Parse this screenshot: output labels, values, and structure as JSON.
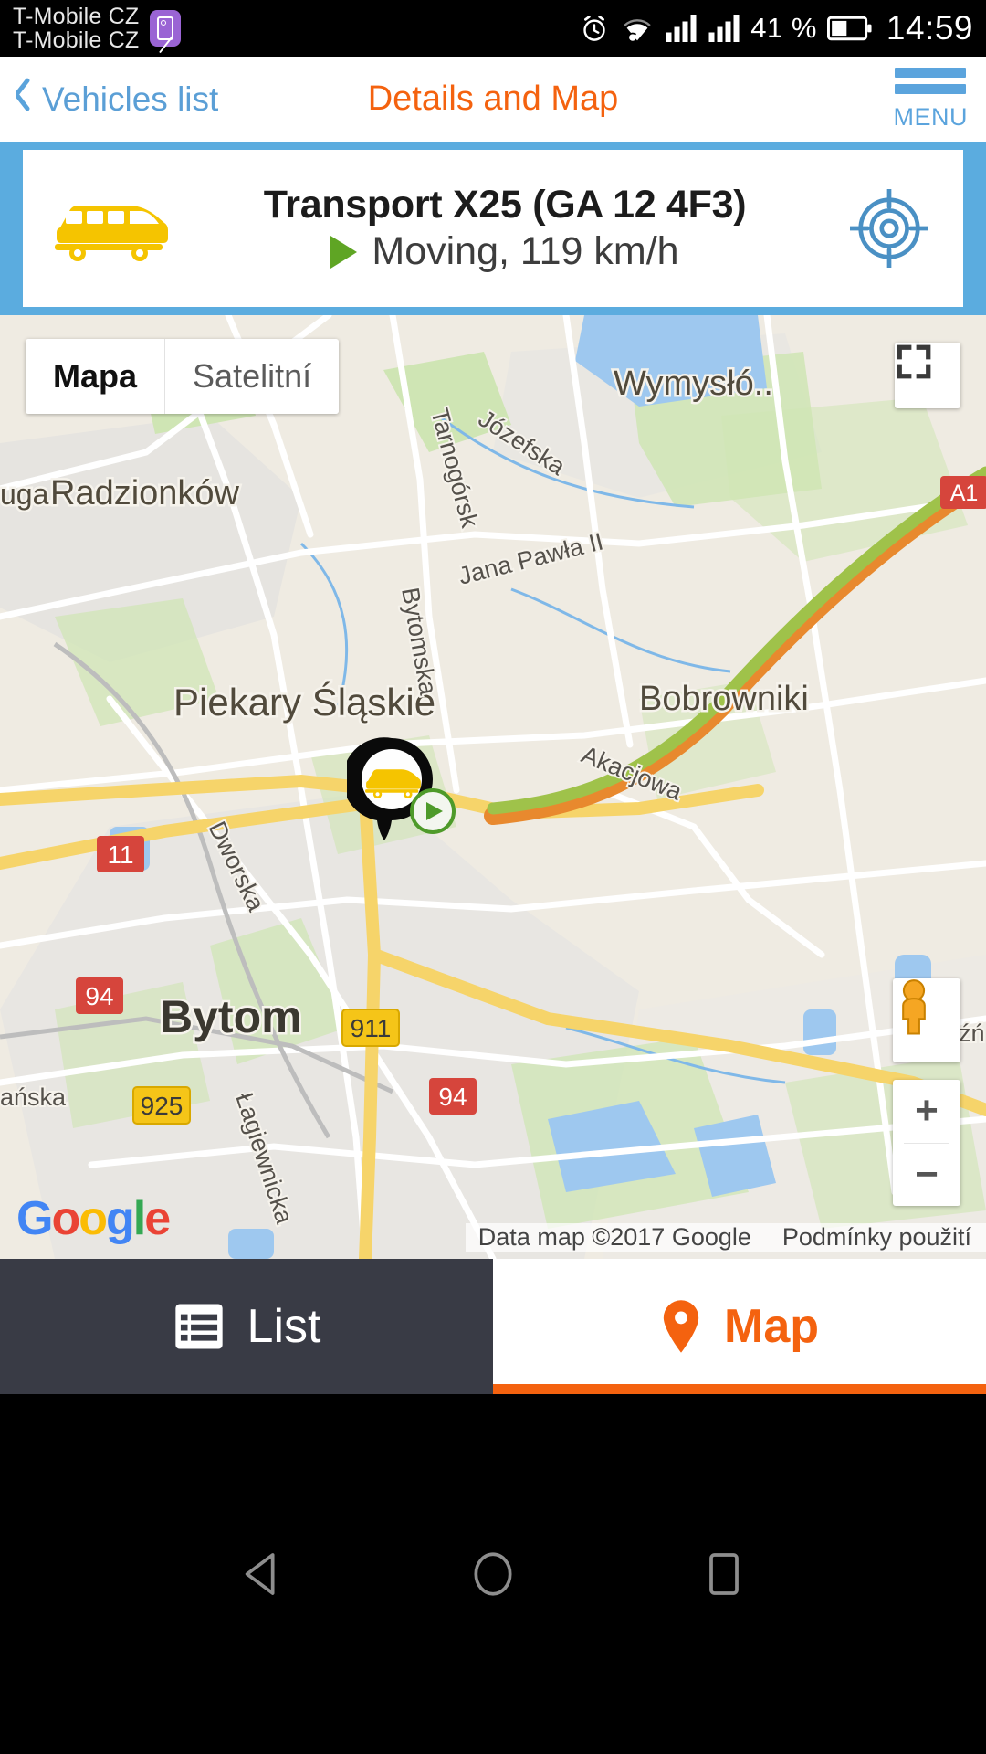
{
  "status_bar": {
    "carrier_line1": "T-Mobile CZ",
    "carrier_line2": "T-Mobile CZ",
    "sim_badge_icon": "sim-card-icon",
    "alarm_icon": "alarm-clock-icon",
    "wifi_icon": "wifi-icon",
    "signal1_icon": "signal-bars-icon",
    "signal2_icon": "signal-bars-icon",
    "battery_percent": "41 %",
    "battery_icon": "battery-icon",
    "clock": "14:59"
  },
  "header": {
    "back_icon": "chevron-left-icon",
    "back_label": "Vehicles list",
    "title": "Details and Map",
    "menu_icon": "hamburger-menu-icon",
    "menu_label": "MENU"
  },
  "vehicle_card": {
    "vehicle_icon": "minibus-icon",
    "name": "Transport X25 (GA 12 4F3)",
    "moving_icon": "play-triangle-icon",
    "status": "Moving, 119 km/h",
    "locate_icon": "crosshair-target-icon"
  },
  "map": {
    "type_buttons": [
      {
        "label": "Mapa",
        "active": true
      },
      {
        "label": "Satelitní",
        "active": false
      }
    ],
    "fullscreen_icon": "fullscreen-expand-icon",
    "pegman_icon": "street-view-pegman-icon",
    "zoom_in_label": "+",
    "zoom_out_label": "−",
    "google_logo": "Google",
    "attribution_data": "Data map ©2017 Google",
    "attribution_terms": "Podmínky použití",
    "marker_icon": "vehicle-map-marker-icon",
    "marker_status_icon": "moving-play-badge-icon",
    "city_labels": [
      "Radzionków",
      "Piekary Śląskie",
      "Bytom",
      "Bobrowniki",
      "Wymysłó..."
    ],
    "street_labels": [
      "Tarnogórsk",
      "Józefska",
      "Jana Pawła II",
      "Bytomska",
      "Akacjowa",
      "Dworska",
      "Łagiewnicka",
      "ńska",
      "uga",
      "źń"
    ],
    "road_shields": [
      {
        "label": "A1",
        "color": "#d6453c"
      },
      {
        "label": "11",
        "color": "#d6453c"
      },
      {
        "label": "94",
        "color": "#d6453c"
      },
      {
        "label": "94",
        "color": "#d6453c"
      },
      {
        "label": "911",
        "color": "#f5c518"
      },
      {
        "label": "925",
        "color": "#f5c518"
      }
    ]
  },
  "bottom_tabs": [
    {
      "label": "List",
      "icon": "list-icon",
      "active": false
    },
    {
      "label": "Map",
      "icon": "map-pin-icon",
      "active": true
    }
  ],
  "nav_bar": {
    "back_icon": "nav-back-triangle-icon",
    "home_icon": "nav-home-circle-icon",
    "recents_icon": "nav-recents-square-icon"
  },
  "colors": {
    "accent_orange": "#f4620f",
    "accent_blue": "#5bacdf",
    "link_blue": "#5b9fd6",
    "tab_dark": "#393b45",
    "vehicle_yellow": "#f5c400",
    "moving_green": "#5fa524"
  }
}
